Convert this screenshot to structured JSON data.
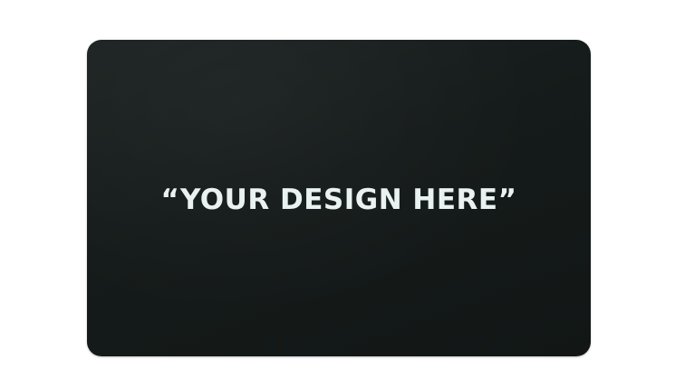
{
  "card": {
    "text": "“YOUR DESIGN HERE”",
    "card_color": "#161c1b",
    "text_color": "#e9f1f1"
  },
  "background_color": "#ffffff"
}
